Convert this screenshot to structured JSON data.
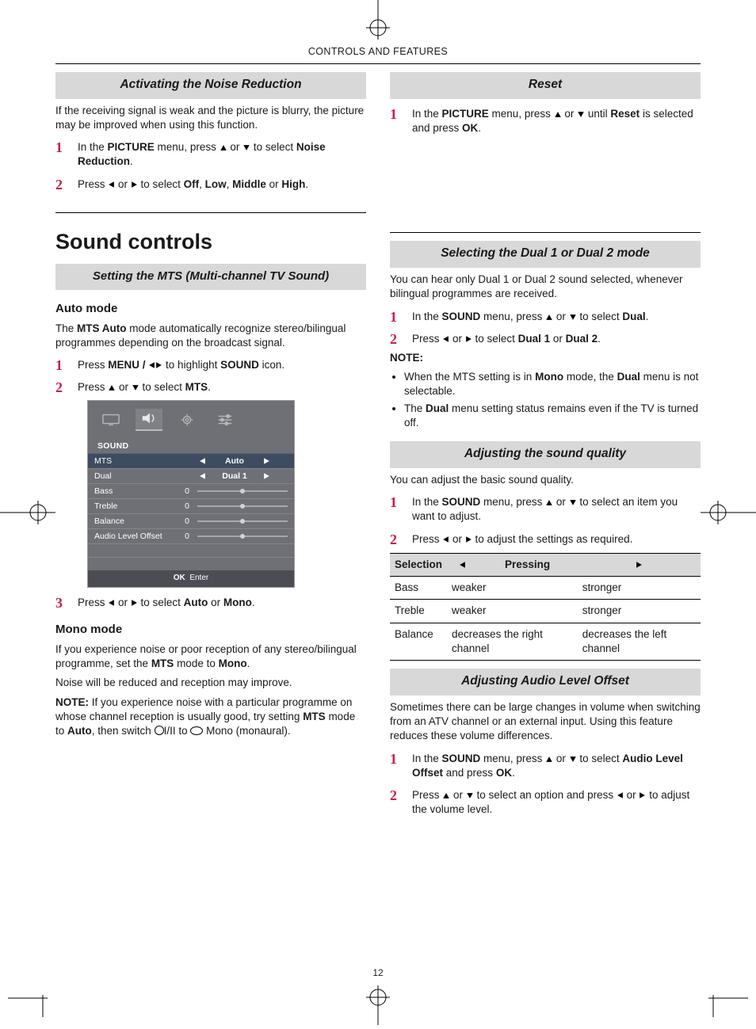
{
  "running_head": "CONTROLS AND FEATURES",
  "page_number": "12",
  "left": {
    "noise_reduction": {
      "title": "Activating the Noise Reduction",
      "intro": "If the receiving signal is weak and the picture is blurry, the picture may be improved when using this function.",
      "step1_pre": "In the ",
      "step1_menu": "PICTURE",
      "step1_mid": " menu, press ",
      "step1_or": " or ",
      "step1_tail": " to select ",
      "step1_target": "Noise Reduction",
      "step1_end": ".",
      "step2_pre": "Press ",
      "step2_or": " or ",
      "step2_mid": " to select ",
      "step2_o1": "Off",
      "step2_c1": ", ",
      "step2_o2": "Low",
      "step2_c2": ", ",
      "step2_o3": "Middle",
      "step2_c3": " or ",
      "step2_o4": "High",
      "step2_end": "."
    },
    "sound_heading": "Sound controls",
    "mts_bar": "Setting the MTS (Multi-channel TV Sound)",
    "auto_mode": {
      "heading": "Auto mode",
      "para_pre": "The ",
      "para_bold": "MTS Auto",
      "para_tail": " mode automatically recognize stereo/bilingual programmes depending on the broadcast signal.",
      "s1_pre": "Press ",
      "s1_menu": "MENU / ",
      "s1_mid": " to highlight ",
      "s1_target": "SOUND",
      "s1_end": " icon.",
      "s2_pre": "Press ",
      "s2_or": " or ",
      "s2_mid": " to select ",
      "s2_target": "MTS",
      "s2_end": "."
    },
    "osd": {
      "title": "SOUND",
      "rows": {
        "mts": {
          "label": "MTS",
          "value": "Auto"
        },
        "dual": {
          "label": "Dual",
          "value": "Dual 1"
        },
        "bass": {
          "label": "Bass",
          "value": "0"
        },
        "treble": {
          "label": "Treble",
          "value": "0"
        },
        "balance": {
          "label": "Balance",
          "value": "0"
        },
        "alo": {
          "label": "Audio Level Offset",
          "value": "0"
        }
      },
      "footer_ok": "OK",
      "footer_enter": "Enter"
    },
    "auto_mode_step3": {
      "pre": "Press ",
      "or": " or ",
      "mid": " to select ",
      "o1": "Auto",
      "c1": " or ",
      "o2": "Mono",
      "end": "."
    },
    "mono_mode": {
      "heading": "Mono mode",
      "p1_pre": "If you experience noise or poor reception of any stereo/bilingual programme, set the ",
      "p1_b1": "MTS",
      "p1_mid": " mode to ",
      "p1_b2": "Mono",
      "p1_end": ".",
      "p2": "Noise will be reduced and reception may improve.",
      "p3_label": "NOTE:",
      "p3_text_a": " If you experience noise with a particular programme on whose channel reception is usually good, try setting ",
      "p3_b1": "MTS",
      "p3_mid1": " mode to ",
      "p3_b2": "Auto",
      "p3_mid2": ", then switch ",
      "p3_glyph_mid": "I/II",
      "p3_mid3": " to ",
      "p3_tail": " Mono (monaural)."
    }
  },
  "right": {
    "reset": {
      "title": "Reset",
      "s1_pre": "In the ",
      "s1_menu": "PICTURE",
      "s1_mid": " menu, press ",
      "s1_or": " or ",
      "s1_mid2": " until ",
      "s1_target": "Reset",
      "s1_mid3": " is selected and press ",
      "s1_ok": "OK",
      "s1_end": "."
    },
    "dual_mode": {
      "title": "Selecting the Dual 1 or Dual 2 mode",
      "intro": "You can hear only Dual 1 or Dual 2 sound selected, whenever bilingual programmes are received.",
      "s1_pre": "In the ",
      "s1_menu": "SOUND",
      "s1_mid": " menu, press ",
      "s1_or": " or ",
      "s1_mid2": " to select ",
      "s1_target": "Dual",
      "s1_end": ".",
      "s2_pre": "Press ",
      "s2_or": " or ",
      "s2_mid": " to select ",
      "s2_a": "Dual 1",
      "s2_c": " or ",
      "s2_b": "Dual 2",
      "s2_end": ".",
      "note_label": "NOTE:",
      "note1_a": "When the MTS setting is in ",
      "note1_b": "Mono",
      "note1_c": " mode, the ",
      "note1_d": "Dual",
      "note1_e": " menu is not selectable.",
      "note2_a": "The ",
      "note2_b": "Dual",
      "note2_c": " menu setting status remains even if the TV is turned off."
    },
    "quality": {
      "title": "Adjusting the sound quality",
      "intro": "You can adjust the basic sound quality.",
      "s1_pre": "In the ",
      "s1_menu": "SOUND",
      "s1_mid": " menu, press ",
      "s1_or": " or ",
      "s1_tail": " to select an item you want to adjust.",
      "s2_pre": "Press ",
      "s2_or": " or ",
      "s2_tail": " to adjust the settings as required.",
      "table": {
        "h_sel": "Selection",
        "h_press": "Pressing",
        "rows": [
          {
            "sel": "Bass",
            "left": "weaker",
            "right": "stronger"
          },
          {
            "sel": "Treble",
            "left": "weaker",
            "right": "stronger"
          },
          {
            "sel": "Balance",
            "left": "decreases the right channel",
            "right": "decreases the left channel"
          }
        ]
      }
    },
    "alo": {
      "title": "Adjusting Audio Level Offset",
      "intro": "Sometimes there can be large changes in volume when switching from an ATV channel or an external input. Using this feature reduces these volume differences.",
      "s1_pre": "In the ",
      "s1_menu": "SOUND",
      "s1_mid": " menu, press ",
      "s1_or": " or ",
      "s1_mid2": " to select ",
      "s1_target": "Audio Level Offset",
      "s1_mid3": " and press ",
      "s1_ok": "OK",
      "s1_end": ".",
      "s2_pre": "Press ",
      "s2_or1": " or ",
      "s2_mid1": " to select an option and press ",
      "s2_or2": " or ",
      "s2_tail": " to adjust the volume level."
    }
  }
}
